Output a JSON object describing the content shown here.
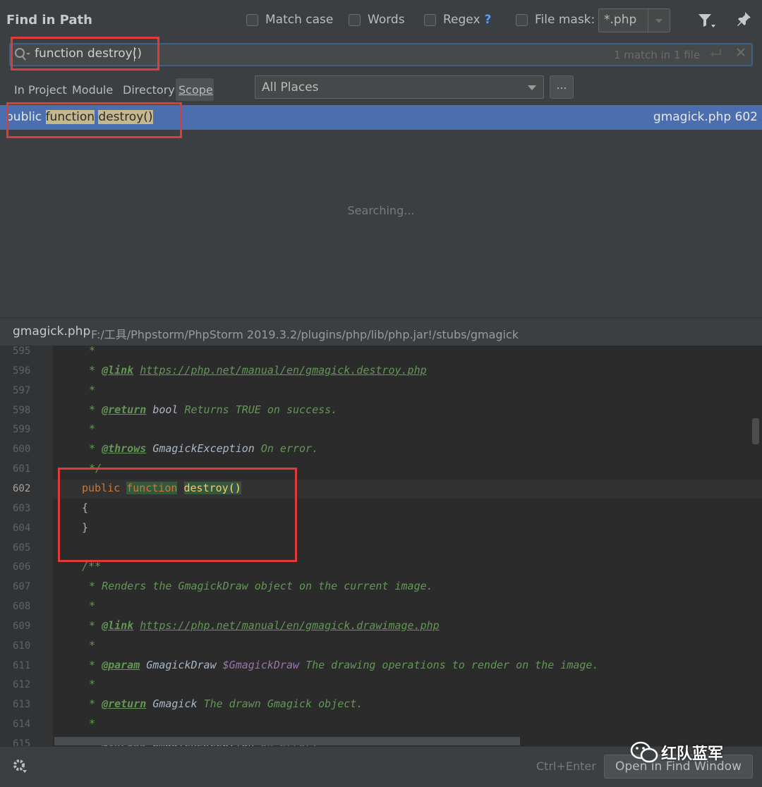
{
  "dialog": {
    "title": "Find in Path"
  },
  "options": {
    "match_case": "Match case",
    "words": "Words",
    "regex": "Regex",
    "regex_help": "?",
    "file_mask_label": "File mask:",
    "file_mask_value": "*.php"
  },
  "search": {
    "query": "function destroy()",
    "match_count": "1 match in 1 file"
  },
  "scopes": {
    "in_project": "In Project",
    "module": "Module",
    "directory": "Directory",
    "scope": "Scope",
    "selected": "All Places",
    "browse": "..."
  },
  "result": {
    "prefix": "public ",
    "fn": "function",
    "name": "destroy()",
    "file": "gmagick.php 602"
  },
  "status": {
    "searching": "Searching..."
  },
  "preview": {
    "file": "gmagick.php",
    "path": "F:/工具/Phpstorm/PhpStorm 2019.3.2/plugins/php/lib/php.jar!/stubs/gmagick",
    "current_line": "602",
    "lines": [
      {
        "n": "595",
        "star": "*"
      },
      {
        "n": "596",
        "star": "* ",
        "tag": "@link",
        "link": "https://php.net/manual/en/gmagick.destroy.php"
      },
      {
        "n": "597",
        "star": "*"
      },
      {
        "n": "598",
        "star": "* ",
        "tag": "@return",
        "type": "bool",
        "text": "Returns TRUE on success."
      },
      {
        "n": "599",
        "star": "*"
      },
      {
        "n": "600",
        "star": "* ",
        "tag": "@throws",
        "type": "GmagickException",
        "text": "On error."
      },
      {
        "n": "601",
        "star": "*/"
      },
      {
        "n": "602",
        "kw": "public",
        "fnkw": "function",
        "fnname": "destroy",
        "paren": "()"
      },
      {
        "n": "603",
        "brace": "{"
      },
      {
        "n": "604",
        "brace": "}"
      },
      {
        "n": "605"
      },
      {
        "n": "606",
        "doc_open": "/**"
      },
      {
        "n": "607",
        "star": "* ",
        "text": "Renders the GmagickDraw object on the current image."
      },
      {
        "n": "608",
        "star": "*"
      },
      {
        "n": "609",
        "star": "* ",
        "tag": "@link",
        "link": "https://php.net/manual/en/gmagick.drawimage.php"
      },
      {
        "n": "610",
        "star": "*"
      },
      {
        "n": "611",
        "star": "* ",
        "tag": "@param",
        "type": "GmagickDraw",
        "var": "$GmagickDraw",
        "text": "The drawing operations to render on the image."
      },
      {
        "n": "612",
        "star": "*"
      },
      {
        "n": "613",
        "star": "* ",
        "tag": "@return",
        "type": "Gmagick",
        "text": "The drawn Gmagick object."
      },
      {
        "n": "614",
        "star": "*"
      },
      {
        "n": "615",
        "star": "* ",
        "tag": "@throws",
        "type": "GmagickException",
        "text": "On error."
      }
    ]
  },
  "footer": {
    "shortcut": "Ctrl+Enter",
    "open_button": "Open in Find Window"
  },
  "watermark": {
    "text": "红队蓝军"
  },
  "colors": {
    "background": "#3c3f41",
    "editor": "#2b2b2b",
    "selection": "#4b6eaf",
    "annotation_red": "#e03b3b"
  }
}
